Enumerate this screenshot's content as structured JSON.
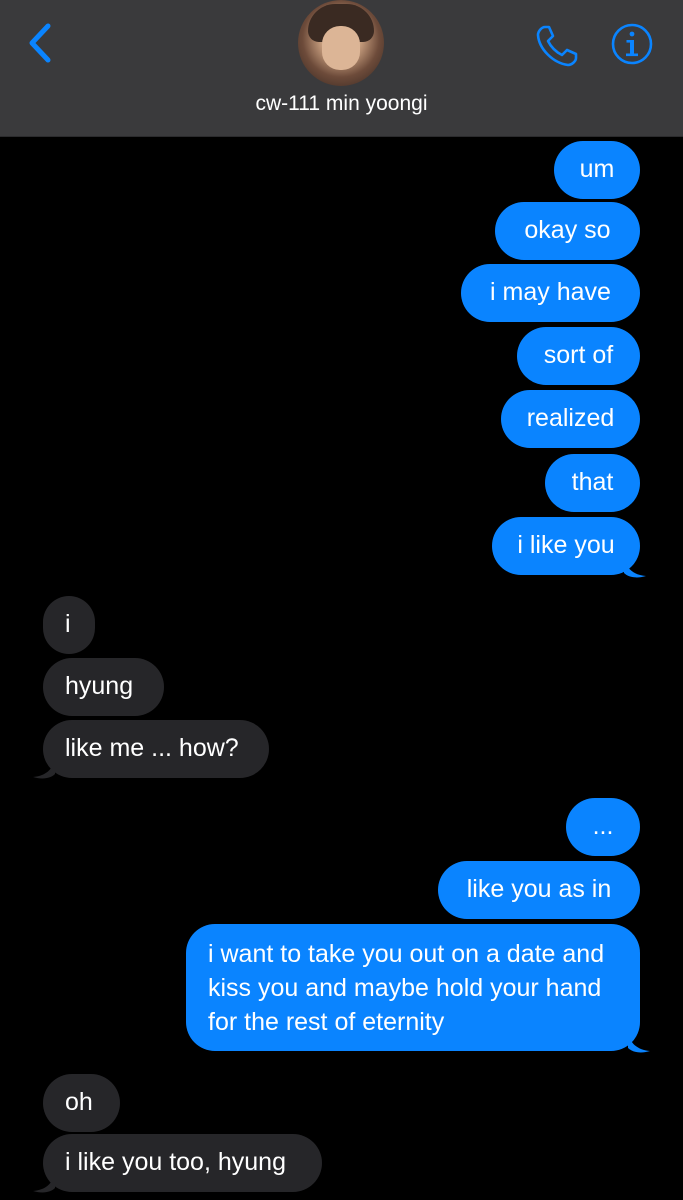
{
  "header": {
    "contact_name": "cw-111 min yoongi",
    "accent_color": "#0a84ff",
    "icons": {
      "back": "chevron-left-icon",
      "phone": "phone-icon",
      "info": "info-icon"
    }
  },
  "messages": [
    {
      "direction": "sent",
      "text": "um"
    },
    {
      "direction": "sent",
      "text": "okay so"
    },
    {
      "direction": "sent",
      "text": "i may have"
    },
    {
      "direction": "sent",
      "text": "sort of"
    },
    {
      "direction": "sent",
      "text": "realized"
    },
    {
      "direction": "sent",
      "text": "that"
    },
    {
      "direction": "sent",
      "text": "i like you"
    },
    {
      "direction": "received",
      "text": "i"
    },
    {
      "direction": "received",
      "text": "hyung"
    },
    {
      "direction": "received",
      "text": "like me ... how?"
    },
    {
      "direction": "sent",
      "text": "..."
    },
    {
      "direction": "sent",
      "text": "like you as in"
    },
    {
      "direction": "sent",
      "text": "i want to take you out on a date and kiss you and maybe hold your hand for the rest of eternity"
    },
    {
      "direction": "received",
      "text": "oh"
    },
    {
      "direction": "received",
      "text": "i like you too, hyung"
    }
  ],
  "colors": {
    "sent_bubble": "#0a84ff",
    "received_bubble": "#262629",
    "header_bg": "#3a3a3c",
    "background": "#000000"
  }
}
